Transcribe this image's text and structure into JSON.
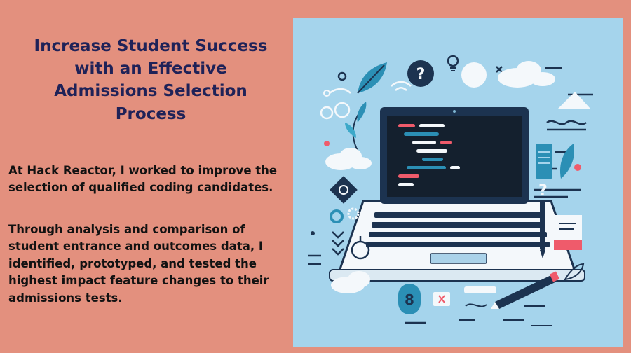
{
  "title": "Increase Student Success\nwith an Effective\nAdmissions Selection\nProcess",
  "paragraph_1": "At Hack Reactor, I worked to improve the selection of qualified coding candidates.",
  "paragraph_2": "Through analysis and comparison of student entrance and outcomes data, I identified, prototyped, and tested the highest impact feature changes to their admissions tests.",
  "colors": {
    "background": "#e3907e",
    "title": "#1f2258",
    "illustration_bg": "#a5d4ec",
    "accent_teal": "#2b8fb5",
    "accent_navy": "#1c3350",
    "accent_red": "#ef5b6b"
  },
  "illustration": {
    "subject": "laptop-with-code",
    "icons": [
      "leaf-icon",
      "question-icon",
      "lightbulb-icon",
      "cloud-icon",
      "wifi-icon",
      "gear-icon",
      "magnifier-icon",
      "pencil-icon",
      "pen-icon",
      "mountain-icon",
      "sticky-note-icon",
      "infinity-icon",
      "close-icon"
    ]
  }
}
